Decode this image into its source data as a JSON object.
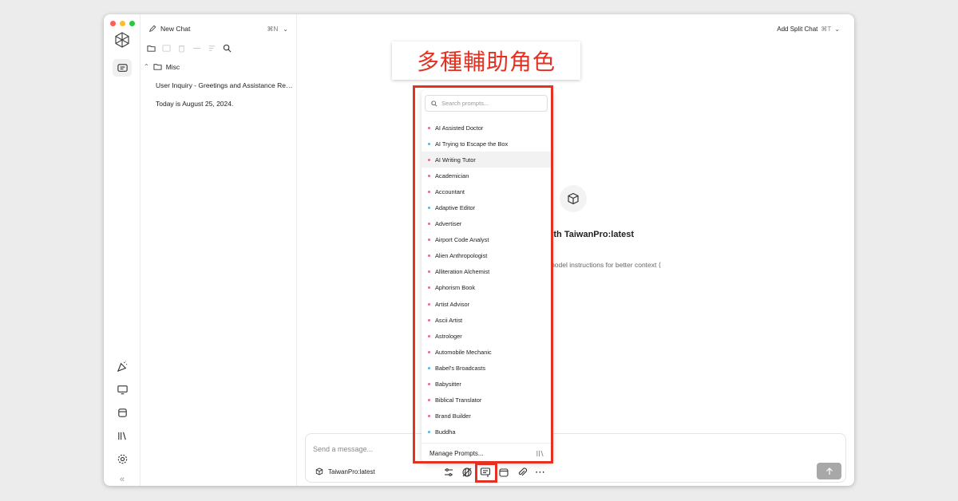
{
  "window": {
    "traffic_colors": [
      "#fe5f57",
      "#febc2e",
      "#28c840"
    ]
  },
  "sidebar": {
    "new_chat_label": "New Chat",
    "new_chat_shortcut": "⌘N",
    "folder_name": "Misc",
    "chats": [
      "User Inquiry - Greetings and Assistance Requested",
      "Today is August 25, 2024."
    ]
  },
  "header": {
    "split_label": "Add Split Chat",
    "split_shortcut": "⌘T"
  },
  "main": {
    "title": "g with TaiwanPro:latest",
    "subtitle": "t model instructions for better context  ⟨"
  },
  "composer": {
    "placeholder": "Send a message...",
    "model": "TaiwanPro:latest"
  },
  "annotation": {
    "banner": "多種輔助角色",
    "accent": "#e43121"
  },
  "prompts": {
    "search_placeholder": "Search prompts...",
    "items": [
      {
        "label": "AI Assisted Doctor",
        "color": "#f0668a"
      },
      {
        "label": "AI Trying to Escape the Box",
        "color": "#4cb7e6"
      },
      {
        "label": "AI Writing Tutor",
        "color": "#f0668a"
      },
      {
        "label": "Academician",
        "color": "#f0668a"
      },
      {
        "label": "Accountant",
        "color": "#f0668a"
      },
      {
        "label": "Adaptive Editor",
        "color": "#4cb7e6"
      },
      {
        "label": "Advertiser",
        "color": "#f0668a"
      },
      {
        "label": "Airport Code Analyst",
        "color": "#f0668a"
      },
      {
        "label": "Alien Anthropologist",
        "color": "#f0668a"
      },
      {
        "label": "Alliteration Alchemist",
        "color": "#f0668a"
      },
      {
        "label": "Aphorism Book",
        "color": "#f0668a"
      },
      {
        "label": "Artist Advisor",
        "color": "#f0668a"
      },
      {
        "label": "Ascii Artist",
        "color": "#f0668a"
      },
      {
        "label": "Astrologer",
        "color": "#f0668a"
      },
      {
        "label": "Automobile Mechanic",
        "color": "#f0668a"
      },
      {
        "label": "Babel's Broadcasts",
        "color": "#4cb7e6"
      },
      {
        "label": "Babysitter",
        "color": "#f0668a"
      },
      {
        "label": "Biblical Translator",
        "color": "#f0668a"
      },
      {
        "label": "Brand Builder",
        "color": "#f0668a"
      },
      {
        "label": "Buddha",
        "color": "#4cb7e6"
      }
    ],
    "hovered_index": 2,
    "manage_label": "Manage Prompts..."
  }
}
